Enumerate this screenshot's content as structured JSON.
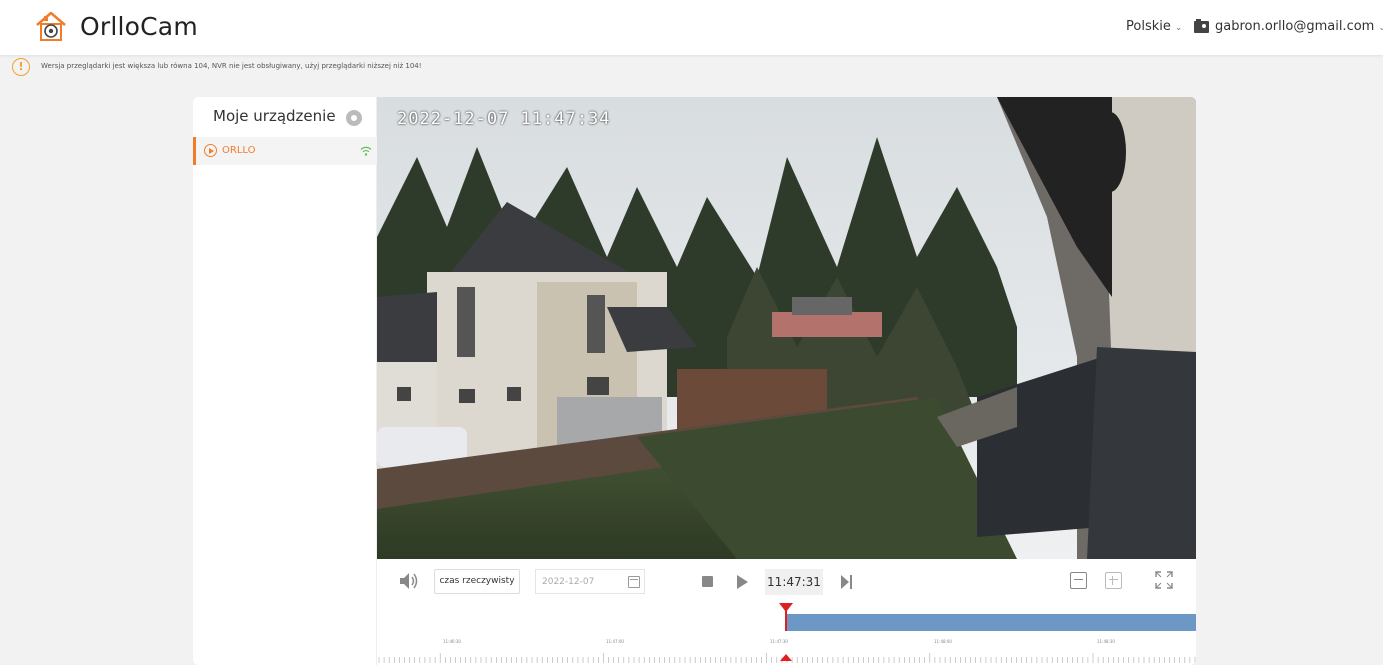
{
  "header": {
    "brand": "OrlloCam",
    "language": "Polskie",
    "user_email": "gabron.orllo@gmail.com",
    "caret": "⌄"
  },
  "warning": {
    "text": "Wersja przeglądarki jest większa lub równa 104, NVR nie jest obsługiwany, użyj przeglądarki niższej niż 104!",
    "icon": "!"
  },
  "sidebar": {
    "title": "Moje urządzenie",
    "devices": [
      {
        "name": "ORLLO",
        "status": "online"
      }
    ]
  },
  "video": {
    "osd_timestamp": "2022-12-07 11:47:34"
  },
  "controls": {
    "live_label": "czas rzeczywisty",
    "date_value": "2022-12-07",
    "time_value": "11:47:31"
  },
  "timeline": {
    "tick_labels": [
      "11:46:30",
      "11:47:00",
      "11:47:30",
      "11:48:00",
      "11:48:30"
    ]
  },
  "colors": {
    "accent": "#f07d2b",
    "recording": "#6d98c6",
    "cursor": "#e02020"
  }
}
